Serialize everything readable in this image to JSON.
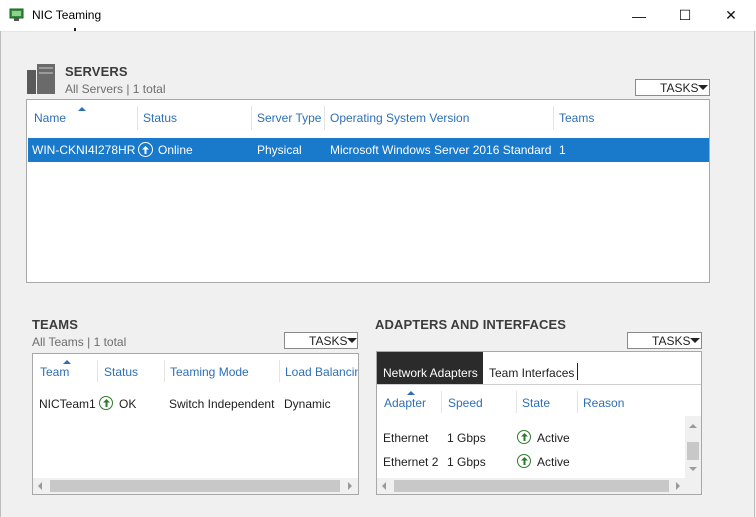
{
  "window": {
    "title": "NIC Teaming",
    "minimize_glyph": "—",
    "maximize_glyph": "☐",
    "close_glyph": "✕"
  },
  "servers": {
    "title": "SERVERS",
    "subtitle": "All Servers | 1 total",
    "tasks_label": "TASKS",
    "columns": [
      "Name",
      "Status",
      "Server Type",
      "Operating System Version",
      "Teams"
    ],
    "rows": [
      {
        "name": "WIN-CKNI4I278HR",
        "status": "Online",
        "server_type": "Physical",
        "os": "Microsoft Windows Server 2016 Standard",
        "teams": "1"
      }
    ]
  },
  "teams": {
    "title": "TEAMS",
    "subtitle": "All Teams | 1 total",
    "tasks_label": "TASKS",
    "columns": [
      "Team",
      "Status",
      "Teaming Mode",
      "Load Balancin"
    ],
    "rows": [
      {
        "team": "NICTeam1",
        "status": "OK",
        "mode": "Switch Independent",
        "lb": "Dynamic"
      }
    ]
  },
  "adapters": {
    "title": "ADAPTERS AND INTERFACES",
    "tasks_label": "TASKS",
    "tabs": [
      "Network Adapters",
      "Team Interfaces"
    ],
    "columns": [
      "Adapter",
      "Speed",
      "State",
      "Reason"
    ],
    "rows": [
      {
        "adapter": "Ethernet",
        "speed": "1 Gbps",
        "state": "Active"
      },
      {
        "adapter": "Ethernet 2",
        "speed": "1 Gbps",
        "state": "Active"
      }
    ]
  },
  "colors": {
    "selection": "#1979ca",
    "link_blue": "#2d6fb6",
    "ok_green": "#2d7a2d",
    "tab_active": "#2b2b2b"
  }
}
